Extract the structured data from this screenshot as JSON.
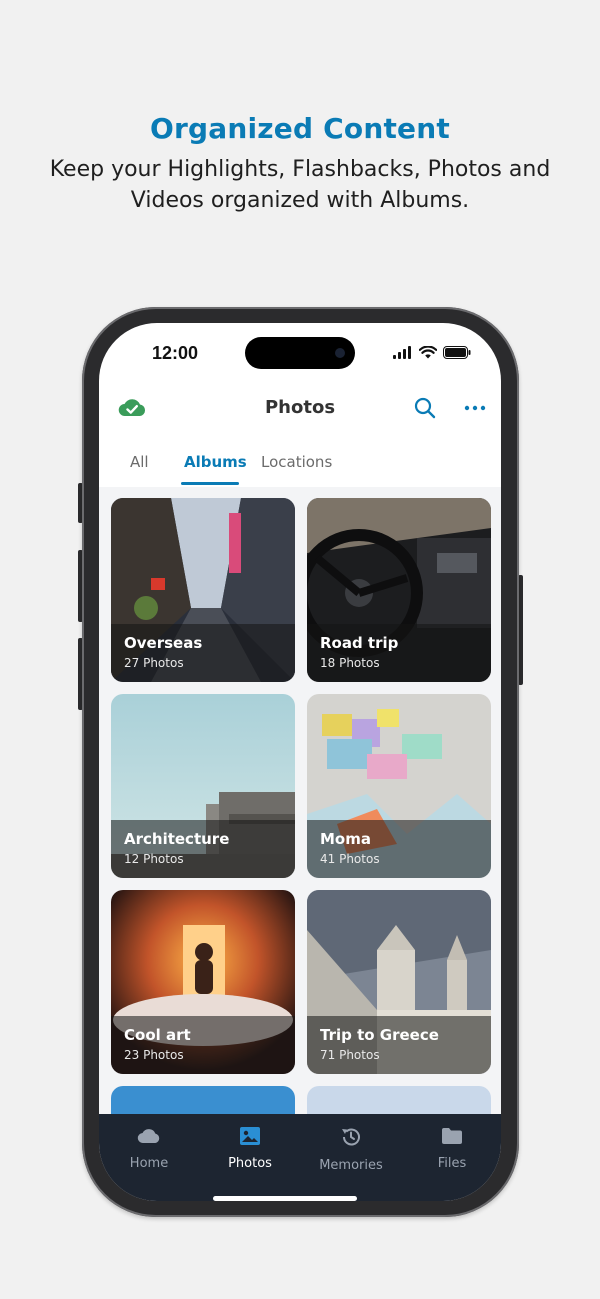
{
  "promo": {
    "headline": "Organized Content",
    "subline": "Keep your Highlights, Flashbacks, Photos and Videos organized with Albums."
  },
  "status_bar": {
    "time": "12:00"
  },
  "app": {
    "title": "Photos",
    "tabs": [
      {
        "label": "All",
        "active": false
      },
      {
        "label": "Albums",
        "active": true
      },
      {
        "label": "Locations",
        "active": false
      }
    ]
  },
  "albums": [
    {
      "name": "Overseas",
      "count": "27 Photos"
    },
    {
      "name": "Road trip",
      "count": "18 Photos"
    },
    {
      "name": "Architecture",
      "count": "12 Photos"
    },
    {
      "name": "Moma",
      "count": "41 Photos"
    },
    {
      "name": "Cool art",
      "count": "23 Photos"
    },
    {
      "name": "Trip to Greece",
      "count": "71 Photos"
    }
  ],
  "bottom_nav": [
    {
      "label": "Home",
      "icon": "cloud-icon",
      "active": false
    },
    {
      "label": "Photos",
      "icon": "image-icon",
      "active": true
    },
    {
      "label": "Memories",
      "icon": "history-icon",
      "active": false
    },
    {
      "label": "Files",
      "icon": "folder-icon",
      "active": false
    }
  ],
  "colors": {
    "accent": "#0a7bb5",
    "sync_green": "#3a9c5a",
    "nav_bg": "#1d2531"
  }
}
